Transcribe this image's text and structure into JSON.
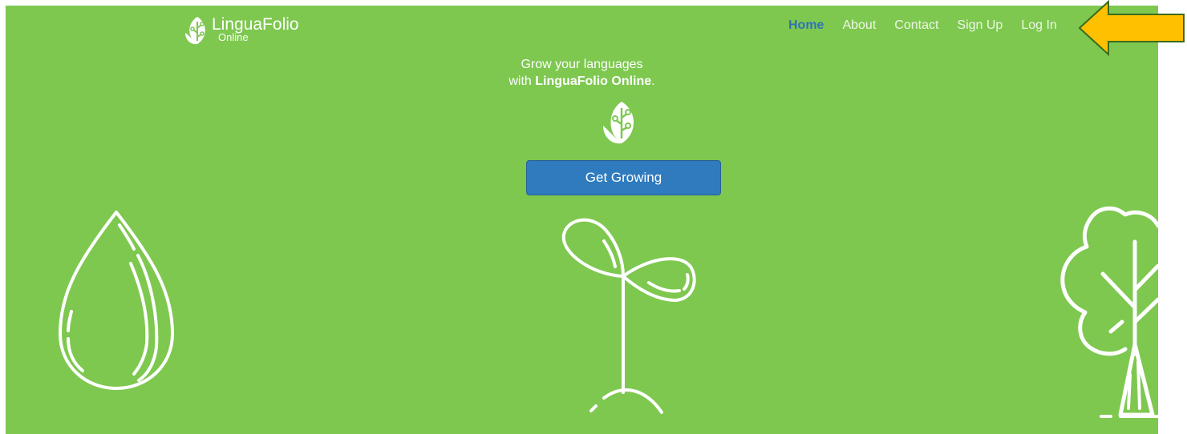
{
  "brand": {
    "name": "LinguaFolio",
    "sub": "Online"
  },
  "nav": {
    "items": [
      {
        "label": "Home",
        "active": true
      },
      {
        "label": "About",
        "active": false
      },
      {
        "label": "Contact",
        "active": false
      },
      {
        "label": "Sign Up",
        "active": false
      },
      {
        "label": "Log In",
        "active": false
      }
    ]
  },
  "hero": {
    "tagline_line1": "Grow your languages",
    "tagline_prefix": "with ",
    "tagline_bold": "LinguaFolio Online",
    "tagline_suffix": ".",
    "cta_label": "Get Growing"
  },
  "icons": {
    "logo": "leaf-logo-icon",
    "center": "leaf-icon",
    "seed": "seed-illustration",
    "sprout": "sprout-illustration",
    "tree": "tree-illustration",
    "pointer": "arrow-pointer"
  },
  "colors": {
    "hero_bg": "#7ec850",
    "accent_blue": "#2f7bbd",
    "nav_active": "#2f73b3",
    "arrow_fill": "#ffc000",
    "arrow_stroke": "#3a6b1e"
  }
}
